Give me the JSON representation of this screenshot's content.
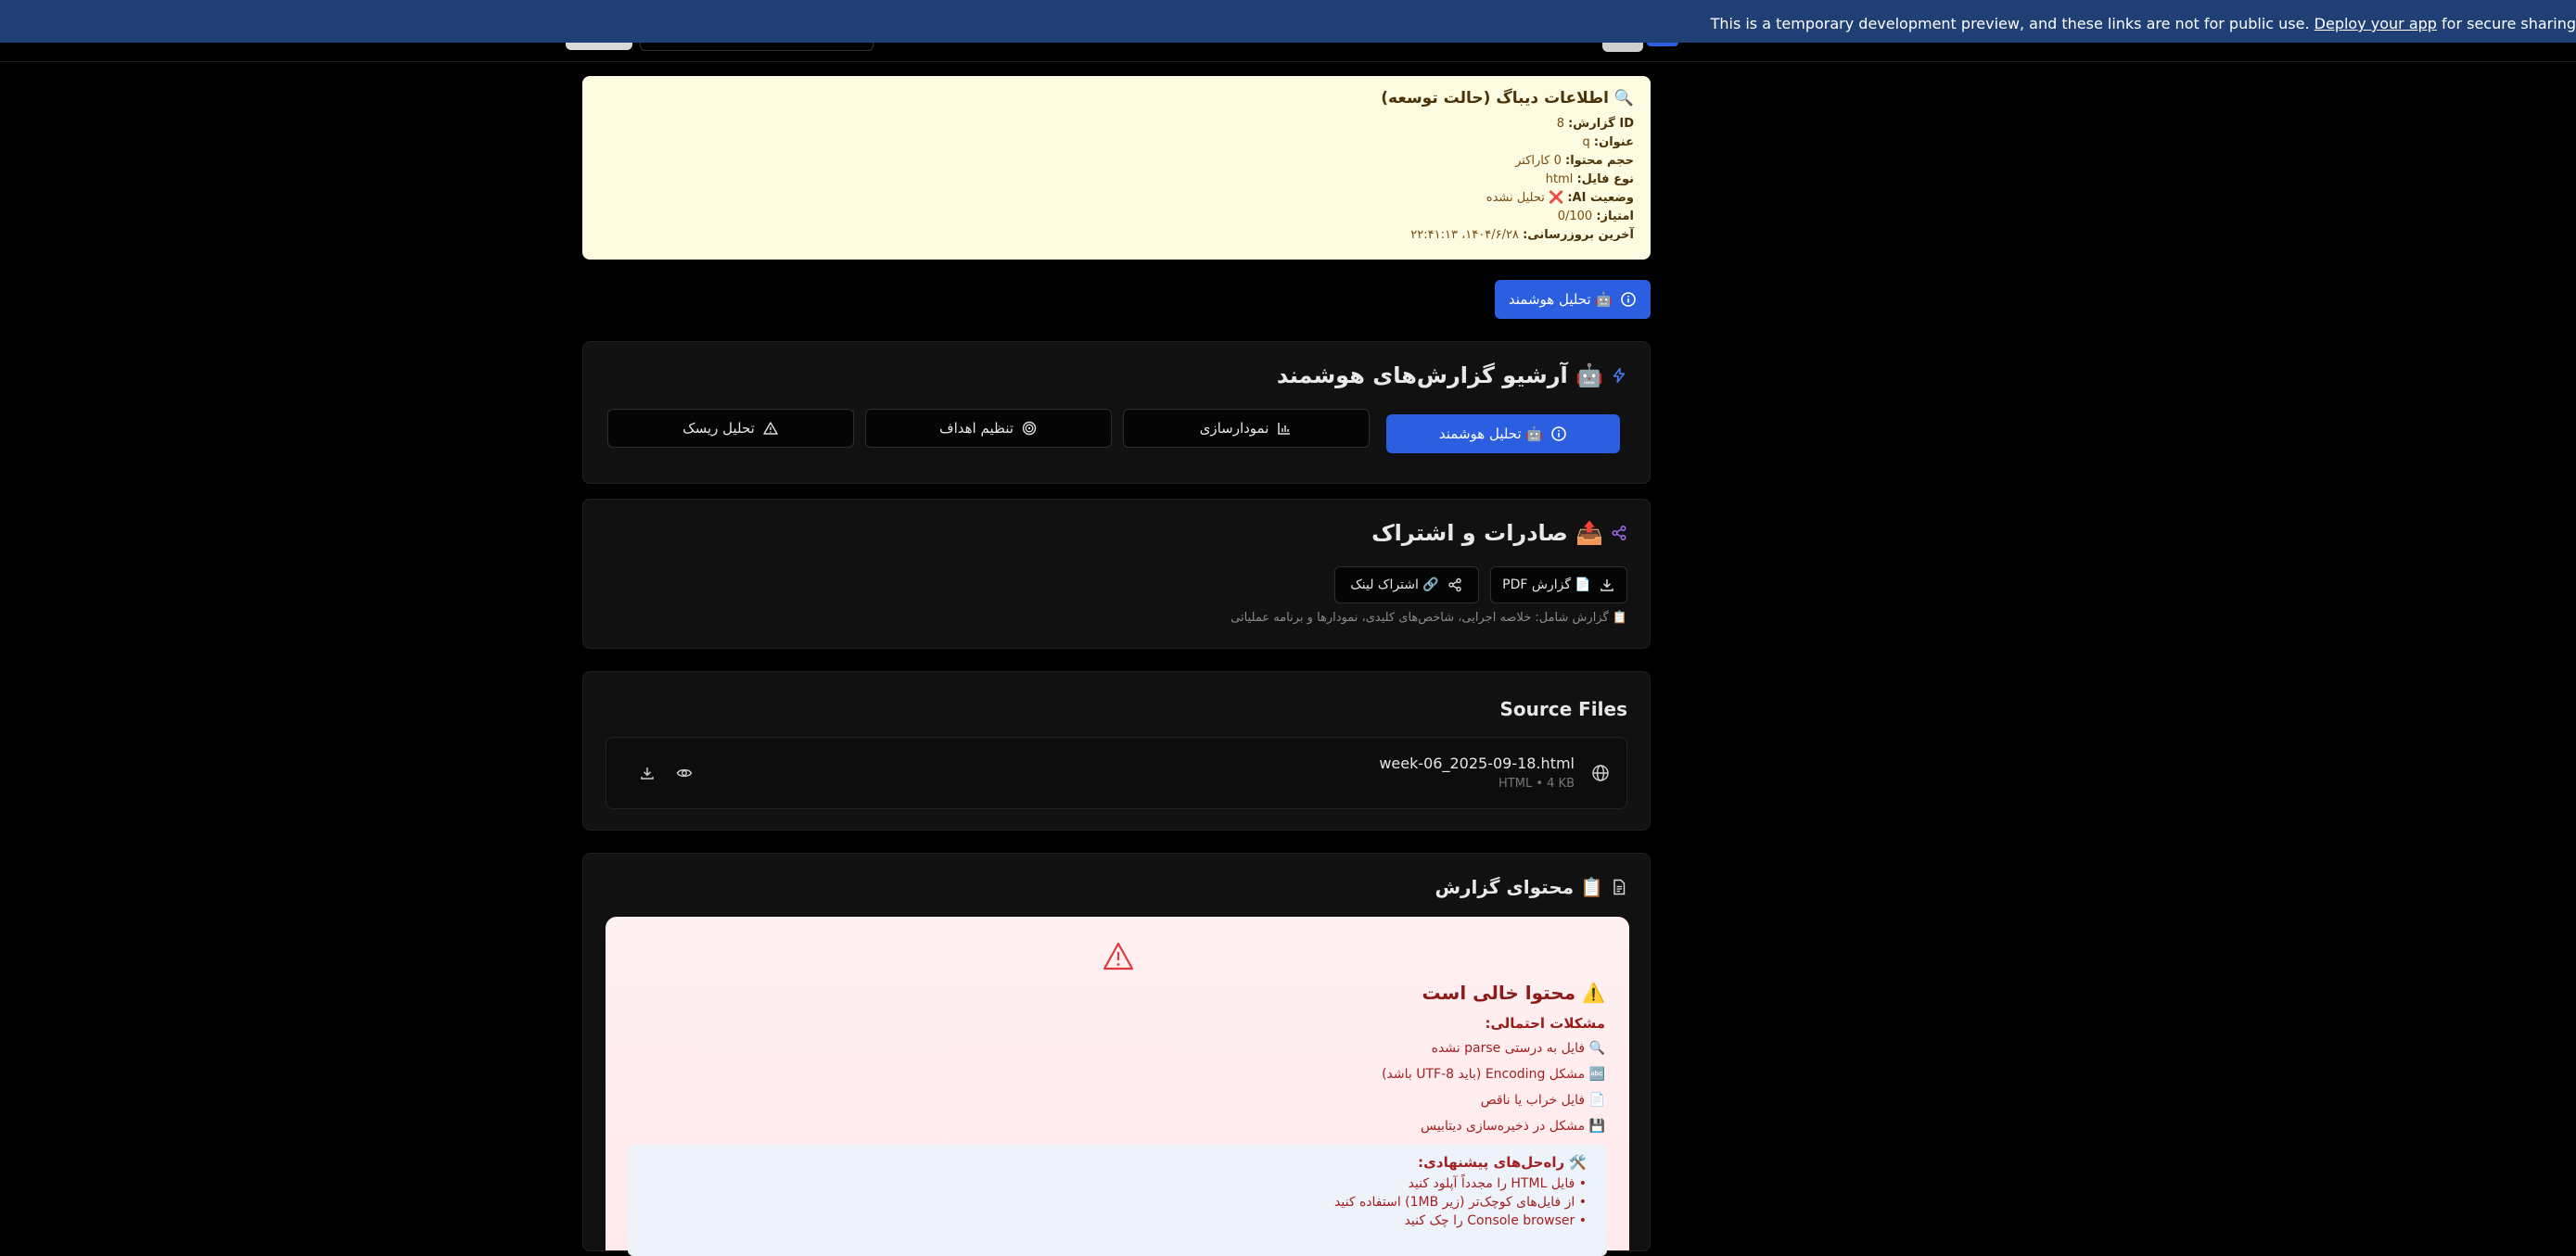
{
  "banner": {
    "prefix": "This is a temporary development preview, and these links are not for public use.",
    "link": "Deploy your app",
    "suffix": " for secure sharing"
  },
  "debug": {
    "title": "🔍 اطلاعات دیباگ (حالت توسعه)",
    "rows": [
      {
        "label": "ID گزارش:",
        "value": "8"
      },
      {
        "label": "عنوان:",
        "value": "q"
      },
      {
        "label": "حجم محتوا:",
        "value": "0 کاراکتر"
      },
      {
        "label": "نوع فایل:",
        "value": "html"
      },
      {
        "label": "وضعیت AI:",
        "value": "❌ تحلیل نشده"
      },
      {
        "label": "امتیاز:",
        "value": "0/100"
      },
      {
        "label": "آخرین بروزرسانی:",
        "value": "۱۴۰۴/۶/۲۸، ۲۲:۴۱:۱۳"
      }
    ]
  },
  "smart_button": {
    "label": "🤖 تحلیل هوشمند"
  },
  "archive": {
    "title": "🤖 آرشیو گزارش‌های هوشمند",
    "tabs": [
      {
        "label": "🤖 تحلیل هوشمند",
        "icon": "info-icon"
      },
      {
        "label": "نمودارسازی",
        "icon": "bar-chart-icon"
      },
      {
        "label": "تنظیم اهداف",
        "icon": "target-icon"
      },
      {
        "label": "تحلیل ریسک",
        "icon": "warning-icon"
      }
    ]
  },
  "export": {
    "title": "📤 صادرات و اشتراک",
    "pdf_label": "📄 گزارش PDF",
    "share_label": "🔗 اشتراک لینک",
    "note": "📋 گزارش شامل: خلاصه اجرایی، شاخص‌های کلیدی، نمودارها و برنامه عملیاتی"
  },
  "source_files": {
    "title": "Source Files",
    "file_name": "week-06_2025-09-18.html",
    "file_meta": "HTML • 4 KB"
  },
  "content": {
    "title": "📋 محتوای گزارش",
    "empty_title": "⚠️ محتوا خالی است",
    "problems_title": "مشکلات احتمالی:",
    "problems": [
      "🔍 فایل به درستی parse نشده",
      "🔤 مشکل Encoding (باید UTF-8 باشد)",
      "📄 فایل خراب یا ناقص",
      "💾 مشکل در ذخیره‌سازی دیتابیس"
    ],
    "solutions_title": "🛠️ راه‌حل‌های پیشنهادی:",
    "solutions": [
      "• فایل HTML را مجدداً آپلود کنید",
      "• از فایل‌های کوچک‌تر (زیر 1MB) استفاده کنید",
      "• Console browser را چک کنید"
    ]
  },
  "colors": {
    "primary": "#2b5fe0",
    "banner": "#1f3f75",
    "debug_bg": "#fefbe3",
    "error": "#9b1b1b"
  }
}
